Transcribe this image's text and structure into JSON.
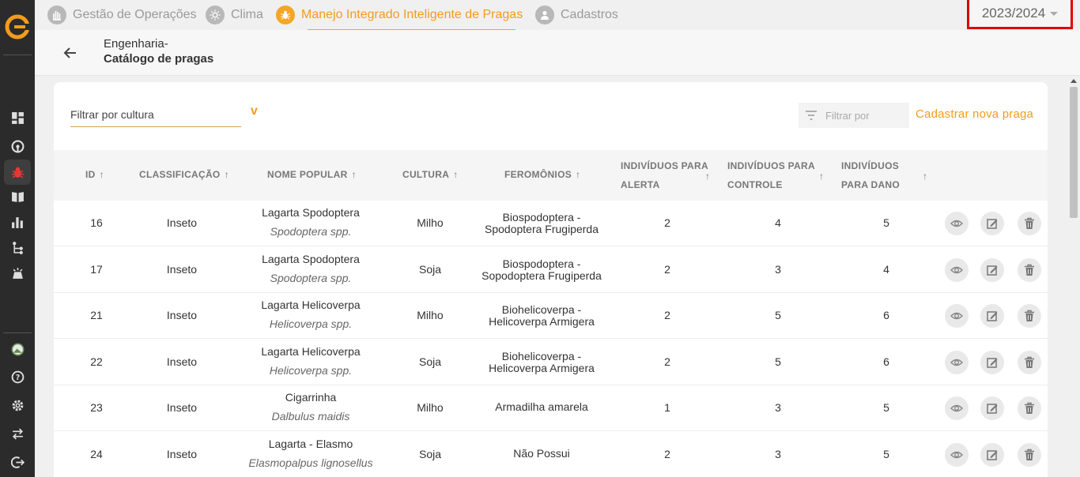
{
  "nav": {
    "items": [
      {
        "label": "Gestão de Operações",
        "icon": "hand-icon"
      },
      {
        "label": "Clima",
        "icon": "sun-icon"
      },
      {
        "label": "Manejo Integrado Inteligente de Pragas",
        "icon": "bug-icon"
      },
      {
        "label": "Cadastros",
        "icon": "person-icon"
      }
    ],
    "year": "2023/2024"
  },
  "header": {
    "breadcrumb_1": "Engenharia-",
    "breadcrumb_2": "Catálogo de pragas"
  },
  "filters": {
    "cultura_placeholder": "Filtrar por cultura",
    "filtrar_placeholder": "Filtrar por",
    "cadastrar_label": "Cadastrar nova praga"
  },
  "table": {
    "headers": {
      "id": "ID",
      "classificacao": "CLASSIFICAÇÃO",
      "nome": "NOME POPULAR",
      "cultura": "CULTURA",
      "feromonios": "FEROMÔNIOS",
      "alerta_1": "INDIVÍDUOS PARA",
      "alerta_2": "ALERTA",
      "controle_1": "INDIVÍDUOS PARA",
      "controle_2": "CONTROLE",
      "dano_1": "INDIVÍDUOS",
      "dano_2": "PARA DANO",
      "arrow": "↑"
    },
    "rows": [
      {
        "id": "16",
        "classificacao": "Inseto",
        "nome": "Lagarta Spodoptera",
        "cientifico": "Spodoptera spp.",
        "cultura": "Milho",
        "fer1": "Biospodoptera -",
        "fer2": "Spodoptera Frugiperda",
        "alerta": "2",
        "controle": "4",
        "dano": "5"
      },
      {
        "id": "17",
        "classificacao": "Inseto",
        "nome": "Lagarta Spodoptera",
        "cientifico": "Spodoptera spp.",
        "cultura": "Soja",
        "fer1": "Biospodoptera -",
        "fer2": "Sopodoptera Frugiperda",
        "alerta": "2",
        "controle": "3",
        "dano": "4"
      },
      {
        "id": "21",
        "classificacao": "Inseto",
        "nome": "Lagarta Helicoverpa",
        "cientifico": "Helicoverpa spp.",
        "cultura": "Milho",
        "fer1": "Biohelicoverpa -",
        "fer2": "Helicoverpa Armigera",
        "alerta": "2",
        "controle": "5",
        "dano": "6"
      },
      {
        "id": "22",
        "classificacao": "Inseto",
        "nome": "Lagarta Helicoverpa",
        "cientifico": "Helicoverpa spp.",
        "cultura": "Soja",
        "fer1": "Biohelicoverpa -",
        "fer2": "Helicoverpa Armigera",
        "alerta": "2",
        "controle": "5",
        "dano": "6"
      },
      {
        "id": "23",
        "classificacao": "Inseto",
        "nome": "Cigarrinha",
        "cientifico": "Dalbulus maidis",
        "cultura": "Milho",
        "fer1": "Armadilha amarela",
        "fer2": "",
        "alerta": "1",
        "controle": "3",
        "dano": "5"
      },
      {
        "id": "24",
        "classificacao": "Inseto",
        "nome": "Lagarta - Elasmo",
        "cientifico": "Elasmopalpus lignosellus",
        "cultura": "Soja",
        "fer1": "Não Possui",
        "fer2": "",
        "alerta": "2",
        "controle": "3",
        "dano": "5"
      }
    ]
  },
  "colors": {
    "accent": "#f29b1d",
    "sidebar": "#2b2b2b",
    "highlight": "#e00000"
  }
}
